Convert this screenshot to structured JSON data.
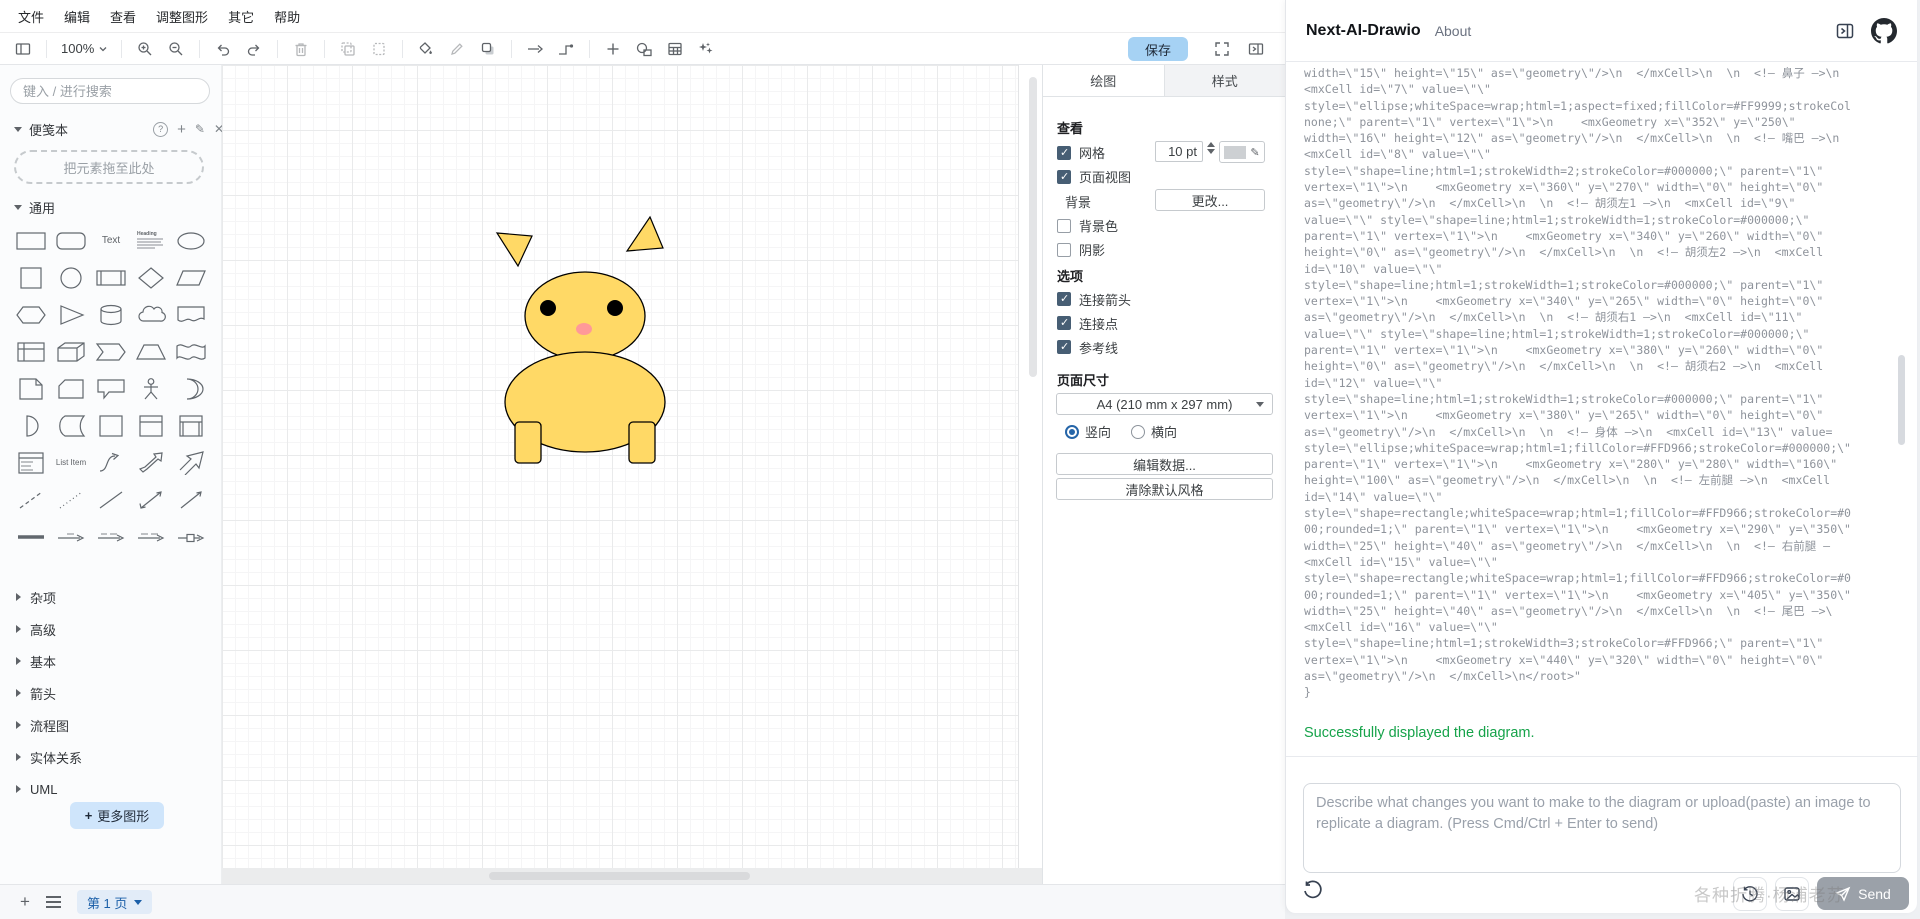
{
  "menu": {
    "items": [
      "文件",
      "编辑",
      "查看",
      "调整图形",
      "其它",
      "帮助"
    ]
  },
  "toolbar": {
    "zoom_value": "100%",
    "save_label": "保存",
    "icon_names": [
      "sidebar-toggle",
      "zoom-in",
      "zoom-out",
      "undo",
      "redo",
      "delete",
      "copy",
      "paste",
      "fill-color",
      "edit-style",
      "shadow",
      "arrow",
      "waypoints",
      "insert",
      "insert-shape",
      "table",
      "ai-sparkles",
      "fullscreen",
      "toggle-format-panel"
    ]
  },
  "sidebar": {
    "search_placeholder": "键入 / 进行搜索",
    "scratchpad": {
      "title": "便笺本",
      "drop_hint": "把元素拖至此处"
    },
    "general": {
      "title": "通用",
      "text_shape_label": "Text",
      "heading_label": "Heading",
      "list_item_label": "List Item"
    },
    "palette_shapes": [
      "rectangle",
      "rounded-rectangle",
      "text",
      "textbox",
      "ellipse",
      "square",
      "circle",
      "process",
      "diamond",
      "parallelogram",
      "hexagon",
      "triangle",
      "cylinder",
      "cloud",
      "document",
      "internal-storage",
      "cube",
      "step",
      "trapezoid",
      "tape",
      "note",
      "card",
      "callout",
      "actor",
      "or",
      "and",
      "data-storage",
      "container",
      "titled-container",
      "list-container",
      "list",
      "list-item",
      "curve",
      "bidirectional-arrow",
      "arrow",
      "dashed-line",
      "dotted-line",
      "line",
      "bidirectional-connector",
      "directional-connector",
      "link",
      "labeled-arrow-1",
      "labeled-arrow-2",
      "labeled-arrow-3",
      "arrow-with-box"
    ],
    "sections": [
      "杂项",
      "高级",
      "基本",
      "箭头",
      "流程图",
      "实体关系",
      "UML"
    ],
    "more_shapes_label": "更多图形"
  },
  "footer": {
    "page_tab": "第 1 页"
  },
  "format_panel": {
    "tabs": {
      "diagram": "绘图",
      "style": "样式"
    },
    "view": {
      "heading": "查看",
      "grid_label": "网格",
      "grid_size": "10 pt",
      "page_view_label": "页面视图",
      "background_label": "背景",
      "change_label": "更改...",
      "background_color_label": "背景色",
      "shadow_label": "阴影"
    },
    "options": {
      "heading": "选项",
      "items": [
        {
          "label": "连接箭头",
          "checked": true
        },
        {
          "label": "连接点",
          "checked": true
        },
        {
          "label": "参考线",
          "checked": true
        }
      ]
    },
    "paper": {
      "heading": "页面尺寸",
      "size_value": "A4 (210 mm x 297 mm)",
      "portrait_label": "竖向",
      "landscape_label": "横向",
      "orientation": "portrait"
    },
    "buttons": {
      "edit_data": "编辑数据...",
      "clear_default_style": "清除默认风格"
    }
  },
  "drawing": {
    "fill": "#FFD966",
    "stroke": "#000000",
    "nose_fill": "#FF9999",
    "eye_fill": "#000000"
  },
  "chat": {
    "title": "Next-AI-Drawio",
    "about_label": "About",
    "code_lines": [
      "width=\\\"15\\\" height=\\\"15\\\" as=\\\"geometry\\\"/>\\n  </mxCell>\\n  \\n  <!— 鼻子 —>\\n",
      "<mxCell id=\\\"7\\\" value=\\\"\\\"",
      "style=\\\"ellipse;whiteSpace=wrap;html=1;aspect=fixed;fillColor=#FF9999;strokeCol",
      "none;\\\" parent=\\\"1\\\" vertex=\\\"1\\\">\\n    <mxGeometry x=\\\"352\\\" y=\\\"250\\\"",
      "width=\\\"16\\\" height=\\\"12\\\" as=\\\"geometry\\\"/>\\n  </mxCell>\\n  \\n  <!— 嘴巴 —>\\n",
      "<mxCell id=\\\"8\\\" value=\\\"\\\"",
      "style=\\\"shape=line;html=1;strokeWidth=2;strokeColor=#000000;\\\" parent=\\\"1\\\"",
      "vertex=\\\"1\\\">\\n    <mxGeometry x=\\\"360\\\" y=\\\"270\\\" width=\\\"0\\\" height=\\\"0\\\"",
      "as=\\\"geometry\\\"/>\\n  </mxCell>\\n  \\n  <!— 胡须左1 —>\\n  <mxCell id=\\\"9\\\"",
      "value=\\\"\\\" style=\\\"shape=line;html=1;strokeWidth=1;strokeColor=#000000;\\\"",
      "parent=\\\"1\\\" vertex=\\\"1\\\">\\n    <mxGeometry x=\\\"340\\\" y=\\\"260\\\" width=\\\"0\\\"",
      "height=\\\"0\\\" as=\\\"geometry\\\"/>\\n  </mxCell>\\n  \\n  <!— 胡须左2 —>\\n  <mxCell",
      "id=\\\"10\\\" value=\\\"\\\"",
      "style=\\\"shape=line;html=1;strokeWidth=1;strokeColor=#000000;\\\" parent=\\\"1\\\"",
      "vertex=\\\"1\\\">\\n    <mxGeometry x=\\\"340\\\" y=\\\"265\\\" width=\\\"0\\\" height=\\\"0\\\"",
      "as=\\\"geometry\\\"/>\\n  </mxCell>\\n  \\n  <!— 胡须右1 —>\\n  <mxCell id=\\\"11\\\"",
      "value=\\\"\\\" style=\\\"shape=line;html=1;strokeWidth=1;strokeColor=#000000;\\\"",
      "parent=\\\"1\\\" vertex=\\\"1\\\">\\n    <mxGeometry x=\\\"380\\\" y=\\\"260\\\" width=\\\"0\\\"",
      "height=\\\"0\\\" as=\\\"geometry\\\"/>\\n  </mxCell>\\n  \\n  <!— 胡须右2 —>\\n  <mxCell",
      "id=\\\"12\\\" value=\\\"\\\"",
      "style=\\\"shape=line;html=1;strokeWidth=1;strokeColor=#000000;\\\" parent=\\\"1\\\"",
      "vertex=\\\"1\\\">\\n    <mxGeometry x=\\\"380\\\" y=\\\"265\\\" width=\\\"0\\\" height=\\\"0\\\"",
      "as=\\\"geometry\\\"/>\\n  </mxCell>\\n  \\n  <!— 身体 —>\\n  <mxCell id=\\\"13\\\" value=",
      "style=\\\"ellipse;whiteSpace=wrap;html=1;fillColor=#FFD966;strokeColor=#000000;\\\"",
      "parent=\\\"1\\\" vertex=\\\"1\\\">\\n    <mxGeometry x=\\\"280\\\" y=\\\"280\\\" width=\\\"160\\\"",
      "height=\\\"100\\\" as=\\\"geometry\\\"/>\\n  </mxCell>\\n  \\n  <!— 左前腿 —>\\n  <mxCell",
      "id=\\\"14\\\" value=\\\"\\\"",
      "style=\\\"shape=rectangle;whiteSpace=wrap;html=1;fillColor=#FFD966;strokeColor=#0",
      "00;rounded=1;\\\" parent=\\\"1\\\" vertex=\\\"1\\\">\\n    <mxGeometry x=\\\"290\\\" y=\\\"350\\\"",
      "width=\\\"25\\\" height=\\\"40\\\" as=\\\"geometry\\\"/>\\n  </mxCell>\\n  \\n  <!— 右前腿 —",
      "<mxCell id=\\\"15\\\" value=\\\"\\\"",
      "style=\\\"shape=rectangle;whiteSpace=wrap;html=1;fillColor=#FFD966;strokeColor=#0",
      "00;rounded=1;\\\" parent=\\\"1\\\" vertex=\\\"1\\\">\\n    <mxGeometry x=\\\"405\\\" y=\\\"350\\\"",
      "width=\\\"25\\\" height=\\\"40\\\" as=\\\"geometry\\\"/>\\n  </mxCell>\\n  \\n  <!— 尾巴 —>\\",
      "<mxCell id=\\\"16\\\" value=\\\"\\\"",
      "style=\\\"shape=line;html=1;strokeWidth=3;strokeColor=#FFD966;\\\" parent=\\\"1\\\"",
      "vertex=\\\"1\\\">\\n    <mxGeometry x=\\\"440\\\" y=\\\"320\\\" width=\\\"0\\\" height=\\\"0\\\"",
      "as=\\\"geometry\\\"/>\\n  </mxCell>\\n</root>\"",
      "}"
    ],
    "success_message": "Successfully displayed the diagram.",
    "input_placeholder": "Describe what changes you want to make to the diagram or upload(paste) an image to replicate a diagram. (Press Cmd/Ctrl + Enter to send)",
    "send_label": "Send",
    "watermark": "各种折腾·杨浦老苏"
  }
}
